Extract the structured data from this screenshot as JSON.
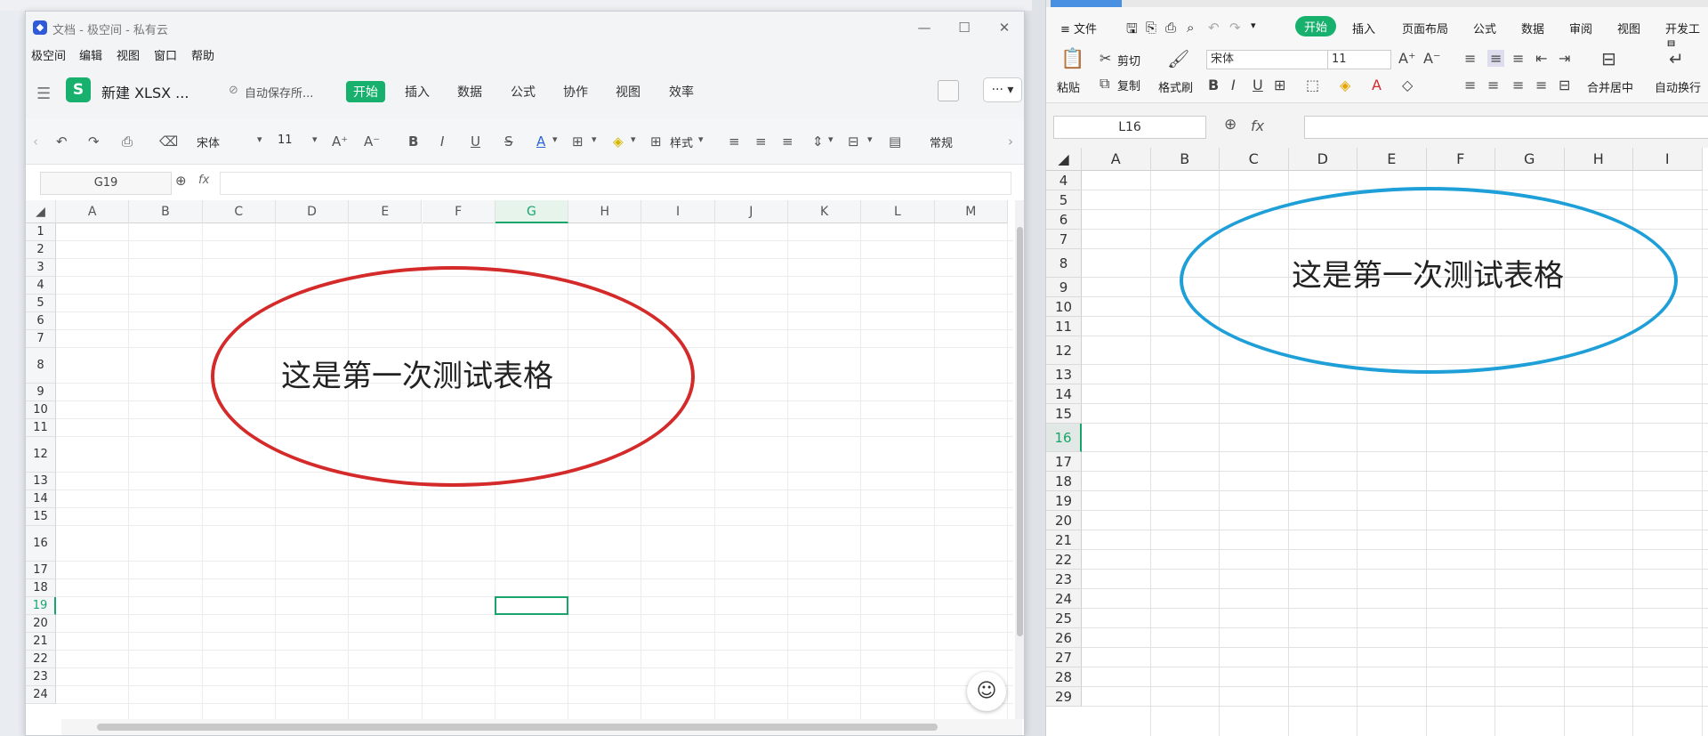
{
  "left_window": {
    "title": "文档 - 极空间 - 私有云",
    "window_controls": {
      "minimize": "—",
      "maximize": "☐",
      "close": "✕"
    },
    "menu": [
      "极空间",
      "编辑",
      "视图",
      "窗口",
      "帮助"
    ],
    "doc_name": "新建 XLSX ...",
    "autosave": "自动保存所...",
    "ribbon_tabs": [
      "开始",
      "插入",
      "数据",
      "公式",
      "协作",
      "视图",
      "效率"
    ],
    "active_tab": "开始",
    "more_label": "··· ▾",
    "toolbar": {
      "font": "宋体",
      "size": "11",
      "style_label": "样式",
      "format_label": "常规"
    },
    "name_box": "G19",
    "fx_label": "fx",
    "columns": [
      "A",
      "B",
      "C",
      "D",
      "E",
      "F",
      "G",
      "H",
      "I",
      "J",
      "K",
      "L",
      "M"
    ],
    "rows": [
      "1",
      "2",
      "3",
      "4",
      "5",
      "6",
      "7",
      "8",
      "9",
      "10",
      "11",
      "12",
      "13",
      "14",
      "15",
      "16",
      "17",
      "18",
      "19",
      "20",
      "21",
      "22",
      "23",
      "24"
    ],
    "active_cell": "G19",
    "shape_text": "这是第一次测试表格",
    "shape_color": "#d42a2a"
  },
  "right_window": {
    "menu_label": "≡ 文件",
    "ribbon_tabs": [
      "开始",
      "插入",
      "页面布局",
      "公式",
      "数据",
      "审阅",
      "视图",
      "开发工具"
    ],
    "active_tab": "开始",
    "ribbon": {
      "paste": "粘贴",
      "cut": "剪切",
      "copy": "复制",
      "format_painter": "格式刷",
      "font": "宋体",
      "size": "11",
      "merge_center": "合并居中",
      "wrap_text": "自动换行"
    },
    "name_box": "L16",
    "fx_label": "fx",
    "columns": [
      "A",
      "B",
      "C",
      "D",
      "E",
      "F",
      "G",
      "H",
      "I"
    ],
    "rows": [
      "4",
      "5",
      "6",
      "7",
      "8",
      "9",
      "10",
      "11",
      "12",
      "13",
      "14",
      "15",
      "16",
      "17",
      "18",
      "19",
      "20",
      "21",
      "22",
      "23",
      "24",
      "25",
      "26",
      "27",
      "28",
      "29"
    ],
    "active_row": "16",
    "shape_text": "这是第一次测试表格",
    "shape_color": "#1f9fd8"
  }
}
